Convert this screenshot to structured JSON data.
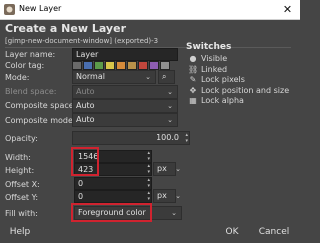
{
  "window": {
    "title": "New Layer",
    "close_glyph": "✕"
  },
  "header": {
    "title": "Create a New Layer",
    "subtitle": "[gimp-new-document-window] (exported)-3"
  },
  "form": {
    "layer_name_label": "Layer name:",
    "layer_name_value": "Layer",
    "color_tag_label": "Color tag:",
    "color_tags": [
      "#6a6a6a",
      "#4a6fb0",
      "#5b9a4a",
      "#d6c44a",
      "#d48a3a",
      "#b8914a",
      "#c0463c",
      "#8d5db1",
      "#8e8e8e"
    ],
    "mode_label": "Mode:",
    "mode_value": "Normal",
    "mode_extra": "⌕",
    "blend_label": "Blend space:",
    "blend_value": "Auto",
    "comp_space_label": "Composite space:",
    "comp_space_value": "Auto",
    "comp_mode_label": "Composite mode:",
    "comp_mode_value": "Auto",
    "opacity_label": "Opacity:",
    "opacity_value": "100.0",
    "width_label": "Width:",
    "width_value": "1546",
    "height_label": "Height:",
    "height_value": "423",
    "unit_value": "px",
    "offset_x_label": "Offset X:",
    "offset_x_value": "0",
    "offset_y_label": "Offset Y:",
    "offset_y_value": "0",
    "offset_unit_value": "px",
    "fill_label": "Fill with:",
    "fill_value": "Foreground color"
  },
  "switches": {
    "title": "Switches",
    "items": [
      {
        "icon": "eye-icon",
        "glyph": "●",
        "label": "Visible"
      },
      {
        "icon": "chain-icon",
        "glyph": "⛓",
        "label": "Linked"
      },
      {
        "icon": "brush-icon",
        "glyph": "✎",
        "label": "Lock pixels"
      },
      {
        "icon": "move-icon",
        "glyph": "✥",
        "label": "Lock position and size"
      },
      {
        "icon": "checker-icon",
        "glyph": "▦",
        "label": "Lock alpha"
      }
    ]
  },
  "buttons": {
    "help": "Help",
    "ok": "OK",
    "cancel": "Cancel"
  },
  "colors": {
    "highlight": "#d0232f",
    "background": "#454545"
  }
}
